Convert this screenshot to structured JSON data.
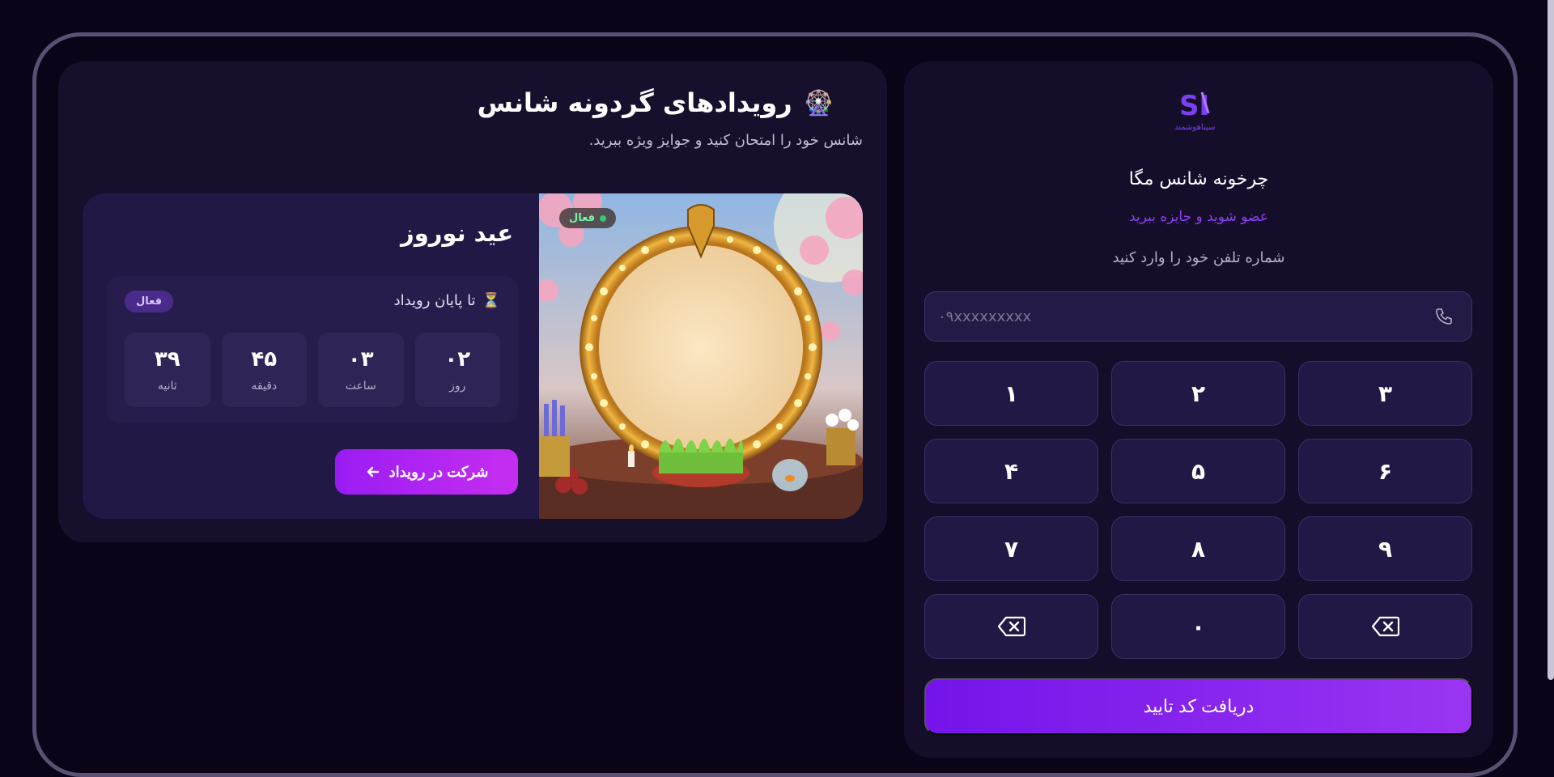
{
  "events": {
    "title_icon": "ferris-wheel-icon",
    "title": "رویدادهای گردونه شانس",
    "subtitle": "شانس خود را امتحان کنید و جوایز ویژه ببرید.",
    "card": {
      "name": "عید نوروز",
      "image_badge": "فعال",
      "countdown_label": "تا پایان رویداد",
      "countdown_icon": "hourglass-icon",
      "status_badge": "فعال",
      "cells": [
        {
          "value": "۰۲",
          "label": "روز"
        },
        {
          "value": "۰۳",
          "label": "ساعت"
        },
        {
          "value": "۴۵",
          "label": "دقیقه"
        },
        {
          "value": "۳۹",
          "label": "ثانیه"
        }
      ],
      "join_label": "شرکت در رویداد",
      "join_icon": "arrow-left-icon"
    }
  },
  "login": {
    "logo_icon": "brand-logo-icon",
    "logo_text": "سیناهوشمند",
    "title": "چرخونه شانس مگا",
    "subtitle": "عضو شوید و جایزه ببرید",
    "phone_label": "شماره تلفن خود را وارد کنید",
    "phone_placeholder": "۰۹xxxxxxxxx",
    "phone_icon": "phone-icon",
    "keys": [
      "۱",
      "۲",
      "۳",
      "۴",
      "۵",
      "۶",
      "۷",
      "۸",
      "۹",
      "",
      "۰",
      ""
    ],
    "key_names": [
      "key-1",
      "key-2",
      "key-3",
      "key-4",
      "key-5",
      "key-6",
      "key-7",
      "key-8",
      "key-9",
      "backspace-left",
      "key-0",
      "backspace-right"
    ],
    "submit_label": "دریافت کد تایید"
  },
  "colors": {
    "background": "#0b0418",
    "accent_purple": "#8d3ff5",
    "active_green": "#34c772"
  }
}
